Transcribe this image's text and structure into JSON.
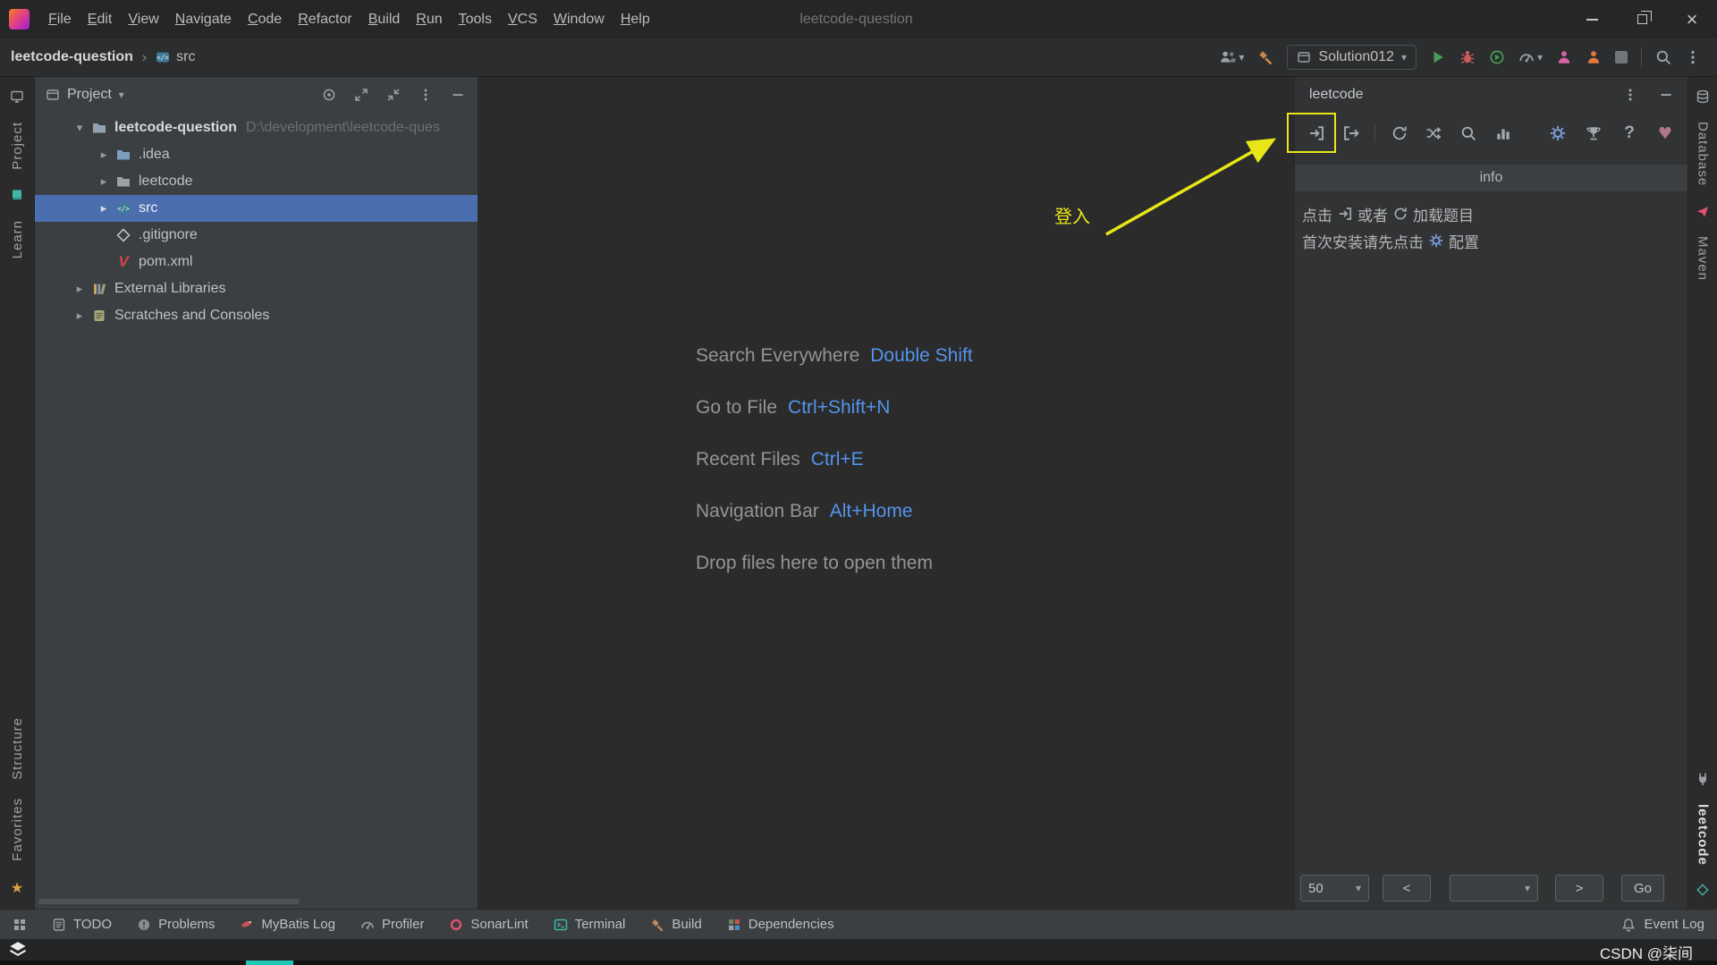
{
  "title_bar": {
    "menus": [
      "File",
      "Edit",
      "View",
      "Navigate",
      "Code",
      "Refactor",
      "Build",
      "Run",
      "Tools",
      "VCS",
      "Window",
      "Help"
    ],
    "window_title": "leetcode-question"
  },
  "nav_bar": {
    "project_crumb": "leetcode-question",
    "crumb_sep": "›",
    "src_crumb": "src",
    "run_config": "Solution012"
  },
  "left_stripe": {
    "project": "Project",
    "learn": "Learn",
    "structure": "Structure",
    "favorites": "Favorites"
  },
  "right_stripe": {
    "database": "Database",
    "maven": "Maven",
    "leetcode": "leetcode"
  },
  "project_panel": {
    "title": "Project",
    "tree": [
      {
        "name": "leetcode-question",
        "path": "D:\\development\\leetcode-ques"
      },
      {
        "name": ".idea"
      },
      {
        "name": "leetcode"
      },
      {
        "name": "src"
      },
      {
        "name": ".gitignore"
      },
      {
        "name": "pom.xml"
      },
      {
        "name": "External Libraries"
      },
      {
        "name": "Scratches and Consoles"
      }
    ]
  },
  "editor": {
    "shortcuts": [
      {
        "action": "Search Everywhere",
        "keys": "Double Shift"
      },
      {
        "action": "Go to File",
        "keys": "Ctrl+Shift+N"
      },
      {
        "action": "Recent Files",
        "keys": "Ctrl+E"
      },
      {
        "action": "Navigation Bar",
        "keys": "Alt+Home"
      }
    ],
    "drop_hint": "Drop files here to open them"
  },
  "leetcode_panel": {
    "title": "leetcode",
    "info_header": "info",
    "annotation_login": "登入",
    "line1_click": "点击",
    "line1_or": "或者",
    "line1_load": "加载题目",
    "line2_first": "首次安装请先点击",
    "line2_config": "配置",
    "pager": {
      "page_size": "50",
      "prev": "<",
      "next": ">",
      "go": "Go"
    }
  },
  "status_bar": {
    "items": [
      "TODO",
      "Problems",
      "MyBatis Log",
      "Profiler",
      "SonarLint",
      "Terminal",
      "Build",
      "Dependencies"
    ],
    "event_log": "Event Log"
  },
  "watermark": "CSDN @柒间",
  "colors": {
    "selection_blue": "#4b6eaf",
    "shortcut_blue": "#5394ec",
    "annotation_yellow": "#e9e618",
    "run_green": "#499c54"
  }
}
